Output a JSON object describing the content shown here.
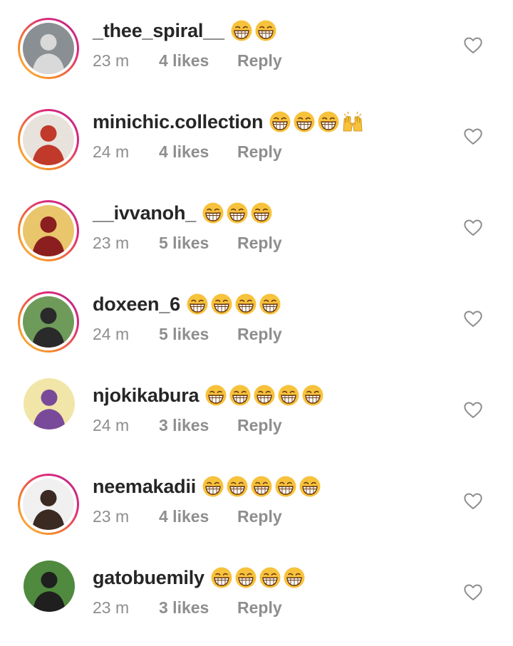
{
  "comments": [
    {
      "username": "_thee_spiral__",
      "time": "23 m",
      "likes": "4 likes",
      "reply": "Reply",
      "emojis": [
        "laugh",
        "laugh"
      ],
      "story": true,
      "avatar_bg": "#8a8f93",
      "avatar_fg": "#d9d9d9"
    },
    {
      "username": "minichic.collection",
      "time": "24 m",
      "likes": "4 likes",
      "reply": "Reply",
      "emojis": [
        "laugh",
        "laugh",
        "laugh",
        "raised-hands"
      ],
      "story": true,
      "avatar_bg": "#e8e2dc",
      "avatar_fg": "#c0392b"
    },
    {
      "username": "__ivvanoh_",
      "time": "23 m",
      "likes": "5 likes",
      "reply": "Reply",
      "emojis": [
        "laugh",
        "laugh",
        "laugh"
      ],
      "story": true,
      "avatar_bg": "#e9c56b",
      "avatar_fg": "#8b1e1e"
    },
    {
      "username": "doxeen_6",
      "time": "24 m",
      "likes": "5 likes",
      "reply": "Reply",
      "emojis": [
        "laugh",
        "laugh",
        "laugh",
        "laugh"
      ],
      "story": true,
      "avatar_bg": "#6e9b5a",
      "avatar_fg": "#2a2a2a"
    },
    {
      "username": "njokikabura",
      "time": "24 m",
      "likes": "3 likes",
      "reply": "Reply",
      "emojis": [
        "laugh",
        "laugh",
        "laugh",
        "laugh",
        "laugh"
      ],
      "story": false,
      "avatar_bg": "#f1e6a8",
      "avatar_fg": "#7a4a9a"
    },
    {
      "username": "neemakadii",
      "time": "23 m",
      "likes": "4 likes",
      "reply": "Reply",
      "emojis": [
        "laugh",
        "laugh",
        "laugh",
        "laugh",
        "laugh"
      ],
      "story": true,
      "avatar_bg": "#f0f0f0",
      "avatar_fg": "#3a2a22"
    },
    {
      "username": "gatobuemily",
      "time": "23 m",
      "likes": "3 likes",
      "reply": "Reply",
      "emojis": [
        "laugh",
        "laugh",
        "laugh",
        "laugh"
      ],
      "story": false,
      "avatar_bg": "#4f8a3e",
      "avatar_fg": "#1f1f1f"
    }
  ],
  "icons": {
    "like": "heart-outline-icon",
    "laugh": "grinning-squinting-face-icon",
    "raised_hands": "raised-hands-icon"
  },
  "colors": {
    "username": "#262626",
    "meta": "#8e8e8e",
    "story_ring_start": "#f9c54a",
    "story_ring_end": "#b22a8a",
    "emoji_yellow": "#f7c23c"
  }
}
